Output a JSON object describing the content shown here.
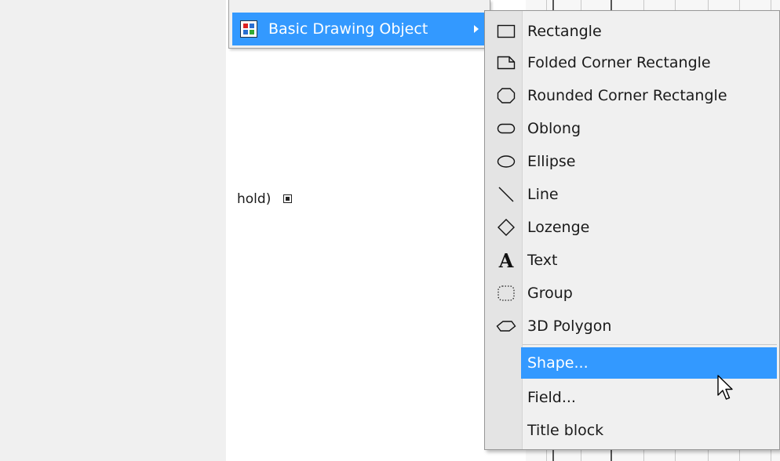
{
  "background": {
    "hold_text": "hold)"
  },
  "parent_menu": {
    "label": "Basic Drawing Object"
  },
  "submenu": {
    "items": [
      {
        "label": "Rectangle",
        "icon": "rectangle-icon"
      },
      {
        "label": "Folded Corner Rectangle",
        "icon": "folded-corner-rectangle-icon"
      },
      {
        "label": "Rounded Corner Rectangle",
        "icon": "rounded-corner-rectangle-icon"
      },
      {
        "label": "Oblong",
        "icon": "oblong-icon"
      },
      {
        "label": "Ellipse",
        "icon": "ellipse-icon"
      },
      {
        "label": "Line",
        "icon": "line-icon"
      },
      {
        "label": "Lozenge",
        "icon": "lozenge-icon"
      },
      {
        "label": "Text",
        "icon": "text-icon"
      },
      {
        "label": "Group",
        "icon": "group-icon"
      },
      {
        "label": "3D Polygon",
        "icon": "3d-polygon-icon"
      }
    ],
    "extra_items": [
      {
        "label": "Shape...",
        "highlighted": true
      },
      {
        "label": "Field...",
        "highlighted": false
      },
      {
        "label": "Title block",
        "highlighted": false
      }
    ]
  },
  "colors": {
    "highlight": "#3399ff",
    "menu_bg": "#f0f0f0",
    "gutter_bg": "#e4e4e4"
  }
}
